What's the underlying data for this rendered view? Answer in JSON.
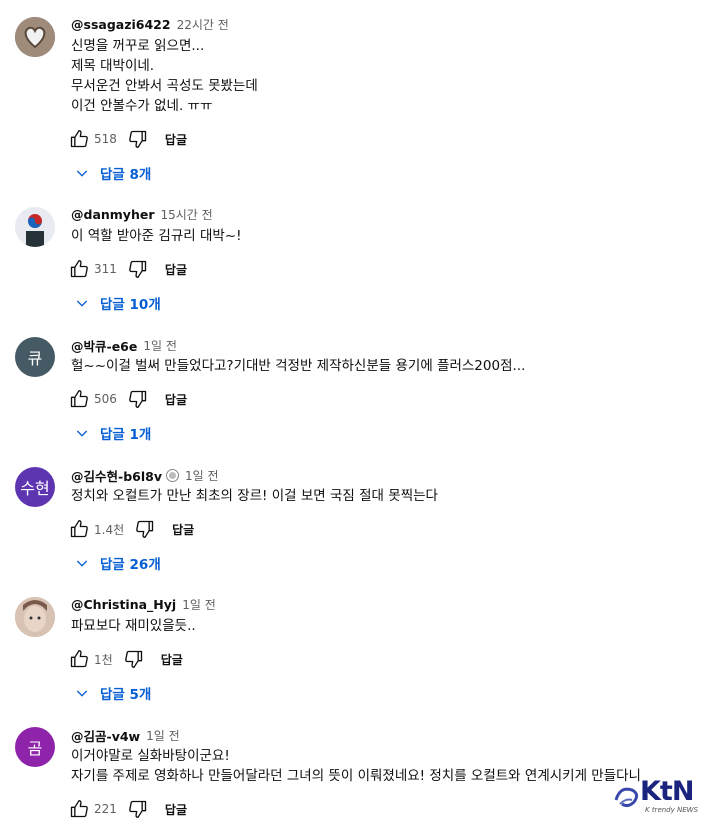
{
  "comments": [
    {
      "author": "@ssagazi6422",
      "time": "22시간 전",
      "lines": [
        "신명을 꺼꾸로 읽으면...",
        "제목 대박이네.",
        "무서운건 안봐서 곡성도 못봤는데",
        "이건 안볼수가 없네. ㅠㅠ"
      ],
      "likes": "518",
      "reply_label": "답글",
      "replies": "답글 8개",
      "avatar_initials": "",
      "avatar_color": "#8a7a6a"
    },
    {
      "author": "@danmyher",
      "time": "15시간 전",
      "lines": [
        "이 역할 받아준 김규리 대박~!"
      ],
      "likes": "311",
      "reply_label": "답글",
      "replies": "답글 10개",
      "avatar_initials": "",
      "avatar_color": "#c8d2e0"
    },
    {
      "author": "@박큐-e6e",
      "time": "1일 전",
      "lines": [
        "헐~~이걸 벌써 만들었다고?기대반 걱정반 제작하신분들 용기에 플러스200점..."
      ],
      "likes": "506",
      "reply_label": "답글",
      "replies": "답글 1개",
      "avatar_initials": "큐",
      "avatar_color": "#455a64"
    },
    {
      "author": "@김수현-b6l8v",
      "time": "1일 전",
      "lines": [
        "정치와 오컬트가 만난 최초의 장르! 이걸 보면 국짐 절대 못찍는다"
      ],
      "likes": "1.4천",
      "reply_label": "답글",
      "replies": "답글 26개",
      "avatar_initials": "수현",
      "avatar_color": "#5e35b1"
    },
    {
      "author": "@Christina_Hyj",
      "time": "1일 전",
      "lines": [
        "파묘보다 재미있을듯.."
      ],
      "likes": "1천",
      "reply_label": "답글",
      "replies": "답글 5개",
      "avatar_initials": "",
      "avatar_color": "#c9a896"
    },
    {
      "author": "@김곰-v4w",
      "time": "1일 전",
      "lines": [
        "이거야말로 실화바탕이군요!",
        "자기를 주제로 영화하나 만들어달라던 그녀의 뜻이 이뤄졌네요! 정치를 오컬트와 연계시키게 만들다니"
      ],
      "likes": "221",
      "reply_label": "답글",
      "replies": "",
      "avatar_initials": "곰",
      "avatar_color": "#8e24aa"
    }
  ],
  "watermark": {
    "name": "KtN",
    "sub": "K trendy NEWS"
  },
  "colors": {
    "link": "#065fd4",
    "muted": "#606060"
  }
}
